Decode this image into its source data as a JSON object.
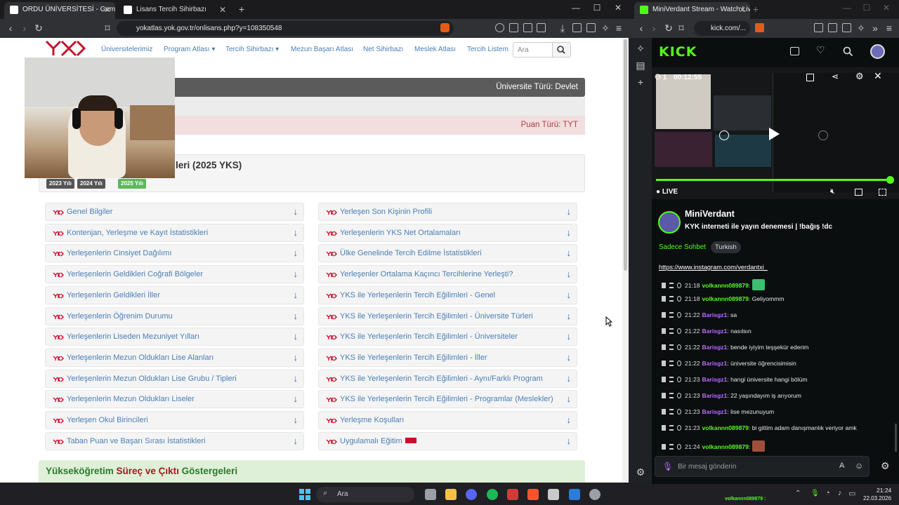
{
  "left_browser": {
    "tabs": [
      {
        "label": "ORDU ÜNİVERSİTESİ - Gemi İnşa"
      },
      {
        "label": "Lisans Tercih Sihirbazı"
      }
    ],
    "url": "yokatlas.yok.gov.tr/onlisans.php?y=108350548",
    "site_nav": [
      "Üniversitelerimiz",
      "Program Atlası ▾",
      "Tercih Sihirbazı ▾",
      "Mezun Başarı Atlası",
      "Net Sihirbazı",
      "Meslek Atlası",
      "Tercih Listem"
    ],
    "search_placeholder": "Ara",
    "university_type": "Üniversite Türü: Devlet",
    "score_type": "Puan Türü: TYT",
    "section_title": "leri (2025 YKS)",
    "year_badges": [
      "2023 Yılı",
      "2024 Yılı",
      "2025 Yılı"
    ],
    "left_items": [
      "Genel Bilgiler",
      "Kontenjan, Yerleşme ve Kayıt İstatistikleri",
      "Yerleşenlerin Cinsiyet Dağılımı",
      "Yerleşenlerin Geldikleri Coğrafi Bölgeler",
      "Yerleşenlerin Geldikleri İller",
      "Yerleşenlerin Öğrenim Durumu",
      "Yerleşenlerin Liseden Mezuniyet Yılları",
      "Yerleşenlerin Mezun Oldukları Lise Alanları",
      "Yerleşenlerin Mezun Oldukları Lise Grubu / Tipleri",
      "Yerleşenlerin Mezun Oldukları Liseler",
      "Yerleşen Okul Birincileri",
      "Taban Puan ve Başarı Sırası İstatistikleri"
    ],
    "right_items": [
      "Yerleşen Son Kişinin Profili",
      "Yerleşenlerin YKS Net Ortalamaları",
      "Ülke Genelinde Tercih Edilme İstatistikleri",
      "Yerleşenler Ortalama Kaçıncı Tercihlerine Yerleşti?",
      "YKS ile Yerleşenlerin Tercih Eğilimleri - Genel",
      "YKS ile Yerleşenlerin Tercih Eğilimleri - Üniversite Türleri",
      "YKS ile Yerleşenlerin Tercih Eğilimleri - Üniversiteler",
      "YKS ile Yerleşenlerin Tercih Eğilimleri - İller",
      "YKS ile Yerleşenlerin Tercih Eğilimleri - Aynı/Farklı Program",
      "YKS ile Yerleşenlerin Tercih Eğilimleri - Programlar (Meslekler)",
      "Yerleşme Koşulları",
      "Uygulamalı Eğitim"
    ],
    "bottom_title_a": "Yükseköğretim ",
    "bottom_title_b": "Süreç ve Çıktı",
    "bottom_title_c": " Göstergeleri"
  },
  "right_browser": {
    "tab": "MiniVerdant Stream - Watch Live",
    "url": "kick.com/...",
    "logo": "KICK",
    "video_viewers": "1",
    "video_time": "00:12:55",
    "live": "LIVE",
    "channel_name": "MiniVerdant",
    "stream_title": "KYK interneti ile yayın denemesi | !bağış !dc",
    "tag_chat": "Sadece Sohbet",
    "tag_lang": "Turkish",
    "instagram": "https://www.instagram.com/verdantxi_",
    "messages": [
      {
        "time": "21:18",
        "user": "volkannn089879",
        "text": ""
      },
      {
        "time": "21:18",
        "user": "volkannn089879",
        "text": "Geliyommm"
      },
      {
        "time": "21:22",
        "user": "Barisgz1",
        "text": "sa"
      },
      {
        "time": "21:22",
        "user": "Barisgz1",
        "text": "nasılsın"
      },
      {
        "time": "21:22",
        "user": "Barisgz1",
        "text": "bende iyiyim teşşekür ederim"
      },
      {
        "time": "21:22",
        "user": "Barisgz1",
        "text": "üniversite öğrencisimisin"
      },
      {
        "time": "21:23",
        "user": "Barisgz1",
        "text": "hangi üniversite hangi bölüm"
      },
      {
        "time": "21:23",
        "user": "Barisgz1",
        "text": "22 yaşındayım iş arıyorum"
      },
      {
        "time": "21:23",
        "user": "Barisgz1",
        "text": "lise mezunuyum"
      },
      {
        "time": "21:23",
        "user": "volkannn089879",
        "text": "bi gittim adam danışmanlık veriyor amk"
      },
      {
        "time": "21:24",
        "user": "volkannn089879",
        "text": ""
      }
    ],
    "message_placeholder": "Bir mesaj gönderin"
  },
  "taskbar": {
    "search": "Ara",
    "notification": "volkannn089879 :",
    "time": "21:24",
    "date": "22.03.2026"
  },
  "colors": {
    "kick_green": "#53fc18",
    "link_blue": "#4a7fb5",
    "yok_red": "#c8102e"
  }
}
